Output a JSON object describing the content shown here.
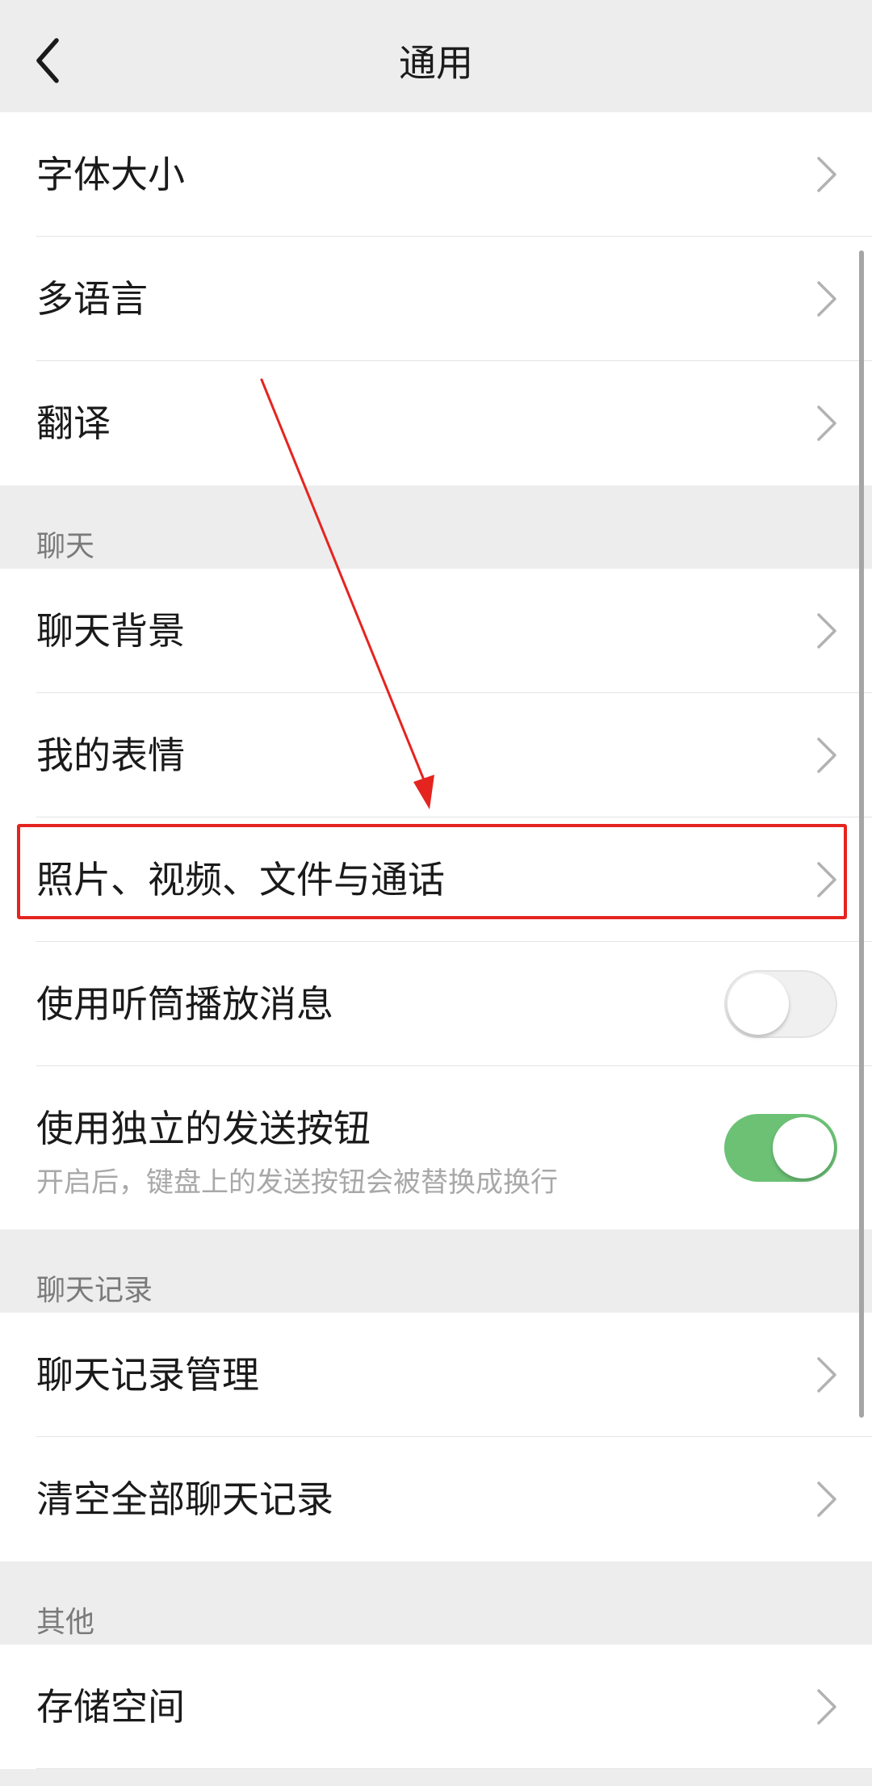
{
  "nav": {
    "title": "通用",
    "back_icon": "chevron-left-icon"
  },
  "groups": [
    {
      "header": "",
      "items": [
        {
          "label": "字体大小",
          "control": "chevron"
        },
        {
          "label": "多语言",
          "control": "chevron"
        },
        {
          "label": "翻译",
          "control": "chevron"
        }
      ]
    },
    {
      "header": "聊天",
      "items": [
        {
          "label": "聊天背景",
          "control": "chevron"
        },
        {
          "label": "我的表情",
          "control": "chevron"
        },
        {
          "label": "照片、视频、文件与通话",
          "control": "chevron",
          "highlighted": true
        },
        {
          "label": "使用听筒播放消息",
          "control": "toggle",
          "toggle_on": false
        },
        {
          "label": "使用独立的发送按钮",
          "sublabel": "开启后，键盘上的发送按钮会被替换成换行",
          "control": "toggle",
          "toggle_on": true
        }
      ]
    },
    {
      "header": "聊天记录",
      "items": [
        {
          "label": "聊天记录管理",
          "control": "chevron"
        },
        {
          "label": "清空全部聊天记录",
          "control": "chevron"
        }
      ]
    },
    {
      "header": "其他",
      "items": [
        {
          "label": "存储空间",
          "control": "chevron"
        }
      ]
    }
  ],
  "colors": {
    "background": "#ededed",
    "row": "#ffffff",
    "toggle_on": "#6cc175",
    "annotation": "#e52420",
    "chevron": "#b2b2b2"
  }
}
